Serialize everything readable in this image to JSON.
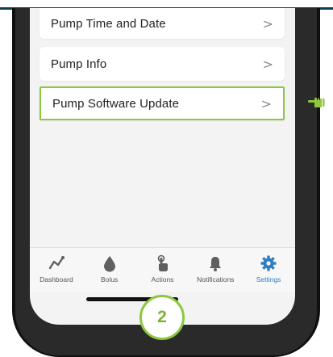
{
  "menu": {
    "items": [
      {
        "label": "Pump Time and Date",
        "chevron": ">"
      },
      {
        "label": "Pump Info",
        "chevron": ">"
      },
      {
        "label": "Pump Software Update",
        "chevron": ">",
        "highlighted": true
      }
    ]
  },
  "tabbar": {
    "tabs": [
      {
        "label": "Dashboard",
        "icon": "trend-line-icon"
      },
      {
        "label": "Bolus",
        "icon": "drop-icon"
      },
      {
        "label": "Actions",
        "icon": "hand-tap-icon"
      },
      {
        "label": "Notifications",
        "icon": "bell-icon"
      },
      {
        "label": "Settings",
        "icon": "gear-icon",
        "active": true
      }
    ]
  },
  "step": {
    "number": "2"
  },
  "colors": {
    "highlight": "#8dc63f",
    "active_tab": "#2f7fc1",
    "inactive_icon": "#5f5f5f",
    "top_rule": "#0f3f52"
  }
}
